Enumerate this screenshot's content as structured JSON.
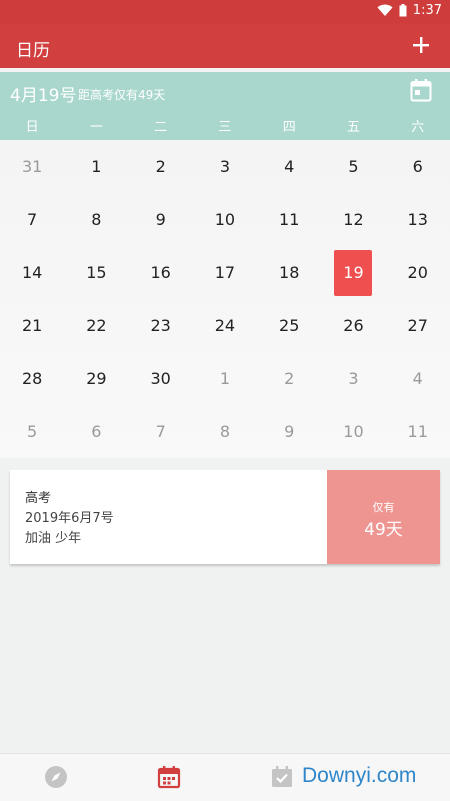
{
  "status": {
    "time": "1:37"
  },
  "app": {
    "title": "日历",
    "add_label": "+"
  },
  "header": {
    "date_title": "4月19号",
    "countdown": "距高考仅有49天"
  },
  "weekdays": [
    "日",
    "一",
    "二",
    "三",
    "四",
    "五",
    "六"
  ],
  "weeks": [
    [
      "31",
      "1",
      "2",
      "3",
      "4",
      "5",
      "6"
    ],
    [
      "7",
      "8",
      "9",
      "10",
      "11",
      "12",
      "13"
    ],
    [
      "14",
      "15",
      "16",
      "17",
      "18",
      "19",
      "20"
    ],
    [
      "21",
      "22",
      "23",
      "24",
      "25",
      "26",
      "27"
    ],
    [
      "28",
      "29",
      "30",
      "1",
      "2",
      "3",
      "4"
    ],
    [
      "5",
      "6",
      "7",
      "8",
      "9",
      "10",
      "11"
    ]
  ],
  "event": {
    "title": "高考",
    "date": "2019年6月7号",
    "note": "加油 少年",
    "remain_label": "仅有",
    "remain_days": "49天"
  },
  "watermark": "Downyi.com",
  "colors": {
    "primary": "#d13f3f",
    "header": "#a9d7cd",
    "today": "#ef4f4f",
    "countdown_box": "#ee9592"
  },
  "nav": {
    "icons": [
      "compass-icon",
      "calendar-icon",
      "checklist-icon"
    ]
  }
}
